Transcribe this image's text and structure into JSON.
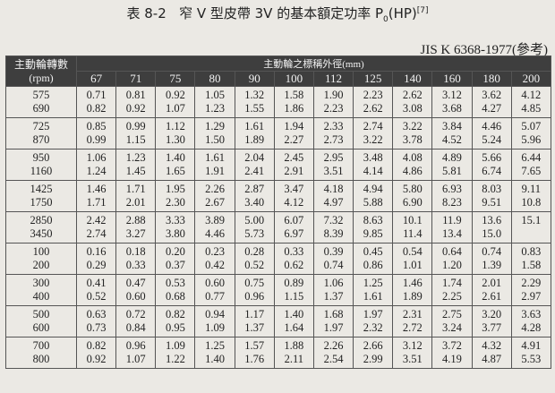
{
  "title": {
    "label": "表 8-2",
    "text": "窄 V 型皮帶 3V 的基本額定功率 P",
    "sub": "0",
    "unit": "(HP)",
    "ref": "[7]"
  },
  "standard": "JIS K 6368-1977(參考)",
  "table": {
    "rpm_header": "主動輪轉數",
    "rpm_unit": "(rpm)",
    "diam_header": "主動輪之標稱外徑(mm)",
    "sizes": [
      "67",
      "71",
      "75",
      "80",
      "90",
      "100",
      "112",
      "125",
      "140",
      "160",
      "180",
      "200"
    ],
    "rows": [
      {
        "rpm": [
          "575",
          "690"
        ],
        "values": [
          [
            "0.71",
            "0.82"
          ],
          [
            "0.81",
            "0.92"
          ],
          [
            "0.92",
            "1.07"
          ],
          [
            "1.05",
            "1.23"
          ],
          [
            "1.32",
            "1.55"
          ],
          [
            "1.58",
            "1.86"
          ],
          [
            "1.90",
            "2.23"
          ],
          [
            "2.23",
            "2.62"
          ],
          [
            "2.62",
            "3.08"
          ],
          [
            "3.12",
            "3.68"
          ],
          [
            "3.62",
            "4.27"
          ],
          [
            "4.12",
            "4.85"
          ]
        ]
      },
      {
        "rpm": [
          "725",
          "870"
        ],
        "values": [
          [
            "0.85",
            "0.99"
          ],
          [
            "0.99",
            "1.15"
          ],
          [
            "1.12",
            "1.30"
          ],
          [
            "1.29",
            "1.50"
          ],
          [
            "1.61",
            "1.89"
          ],
          [
            "1.94",
            "2.27"
          ],
          [
            "2.33",
            "2.73"
          ],
          [
            "2.74",
            "3.22"
          ],
          [
            "3.22",
            "3.78"
          ],
          [
            "3.84",
            "4.52"
          ],
          [
            "4.46",
            "5.24"
          ],
          [
            "5.07",
            "5.96"
          ]
        ]
      },
      {
        "rpm": [
          "950",
          "1160"
        ],
        "values": [
          [
            "1.06",
            "1.24"
          ],
          [
            "1.23",
            "1.45"
          ],
          [
            "1.40",
            "1.65"
          ],
          [
            "1.61",
            "1.91"
          ],
          [
            "2.04",
            "2.41"
          ],
          [
            "2.45",
            "2.91"
          ],
          [
            "2.95",
            "3.51"
          ],
          [
            "3.48",
            "4.14"
          ],
          [
            "4.08",
            "4.86"
          ],
          [
            "4.89",
            "5.81"
          ],
          [
            "5.66",
            "6.74"
          ],
          [
            "6.44",
            "7.65"
          ]
        ]
      },
      {
        "rpm": [
          "1425",
          "1750"
        ],
        "values": [
          [
            "1.46",
            "1.71"
          ],
          [
            "1.71",
            "2.01"
          ],
          [
            "1.95",
            "2.30"
          ],
          [
            "2.26",
            "2.67"
          ],
          [
            "2.87",
            "3.40"
          ],
          [
            "3.47",
            "4.12"
          ],
          [
            "4.18",
            "4.97"
          ],
          [
            "4.94",
            "5.88"
          ],
          [
            "5.80",
            "6.90"
          ],
          [
            "6.93",
            "8.23"
          ],
          [
            "8.03",
            "9.51"
          ],
          [
            "9.11",
            "10.8"
          ]
        ]
      },
      {
        "rpm": [
          "2850",
          "3450"
        ],
        "values": [
          [
            "2.42",
            "2.74"
          ],
          [
            "2.88",
            "3.27"
          ],
          [
            "3.33",
            "3.80"
          ],
          [
            "3.89",
            "4.46"
          ],
          [
            "5.00",
            "5.73"
          ],
          [
            "6.07",
            "6.97"
          ],
          [
            "7.32",
            "8.39"
          ],
          [
            "8.63",
            "9.85"
          ],
          [
            "10.1",
            "11.4"
          ],
          [
            "11.9",
            "13.4"
          ],
          [
            "13.6",
            "15.0"
          ],
          [
            "15.1",
            ""
          ]
        ]
      },
      {
        "rpm": [
          "100",
          "200"
        ],
        "values": [
          [
            "0.16",
            "0.29"
          ],
          [
            "0.18",
            "0.33"
          ],
          [
            "0.20",
            "0.37"
          ],
          [
            "0.23",
            "0.42"
          ],
          [
            "0.28",
            "0.52"
          ],
          [
            "0.33",
            "0.62"
          ],
          [
            "0.39",
            "0.74"
          ],
          [
            "0.45",
            "0.86"
          ],
          [
            "0.54",
            "1.01"
          ],
          [
            "0.64",
            "1.20"
          ],
          [
            "0.74",
            "1.39"
          ],
          [
            "0.83",
            "1.58"
          ]
        ]
      },
      {
        "rpm": [
          "300",
          "400"
        ],
        "values": [
          [
            "0.41",
            "0.52"
          ],
          [
            "0.47",
            "0.60"
          ],
          [
            "0.53",
            "0.68"
          ],
          [
            "0.60",
            "0.77"
          ],
          [
            "0.75",
            "0.96"
          ],
          [
            "0.89",
            "1.15"
          ],
          [
            "1.06",
            "1.37"
          ],
          [
            "1.25",
            "1.61"
          ],
          [
            "1.46",
            "1.89"
          ],
          [
            "1.74",
            "2.25"
          ],
          [
            "2.01",
            "2.61"
          ],
          [
            "2.29",
            "2.97"
          ]
        ]
      },
      {
        "rpm": [
          "500",
          "600"
        ],
        "values": [
          [
            "0.63",
            "0.73"
          ],
          [
            "0.72",
            "0.84"
          ],
          [
            "0.82",
            "0.95"
          ],
          [
            "0.94",
            "1.09"
          ],
          [
            "1.17",
            "1.37"
          ],
          [
            "1.40",
            "1.64"
          ],
          [
            "1.68",
            "1.97"
          ],
          [
            "1.97",
            "2.32"
          ],
          [
            "2.31",
            "2.72"
          ],
          [
            "2.75",
            "3.24"
          ],
          [
            "3.20",
            "3.77"
          ],
          [
            "3.63",
            "4.28"
          ]
        ]
      },
      {
        "rpm": [
          "700",
          "800"
        ],
        "values": [
          [
            "0.82",
            "0.92"
          ],
          [
            "0.96",
            "1.07"
          ],
          [
            "1.09",
            "1.22"
          ],
          [
            "1.25",
            "1.40"
          ],
          [
            "1.57",
            "1.76"
          ],
          [
            "1.88",
            "2.11"
          ],
          [
            "2.26",
            "2.54"
          ],
          [
            "2.66",
            "2.99"
          ],
          [
            "3.12",
            "3.51"
          ],
          [
            "3.72",
            "4.19"
          ],
          [
            "4.32",
            "4.87"
          ],
          [
            "4.91",
            "5.53"
          ]
        ]
      }
    ]
  }
}
